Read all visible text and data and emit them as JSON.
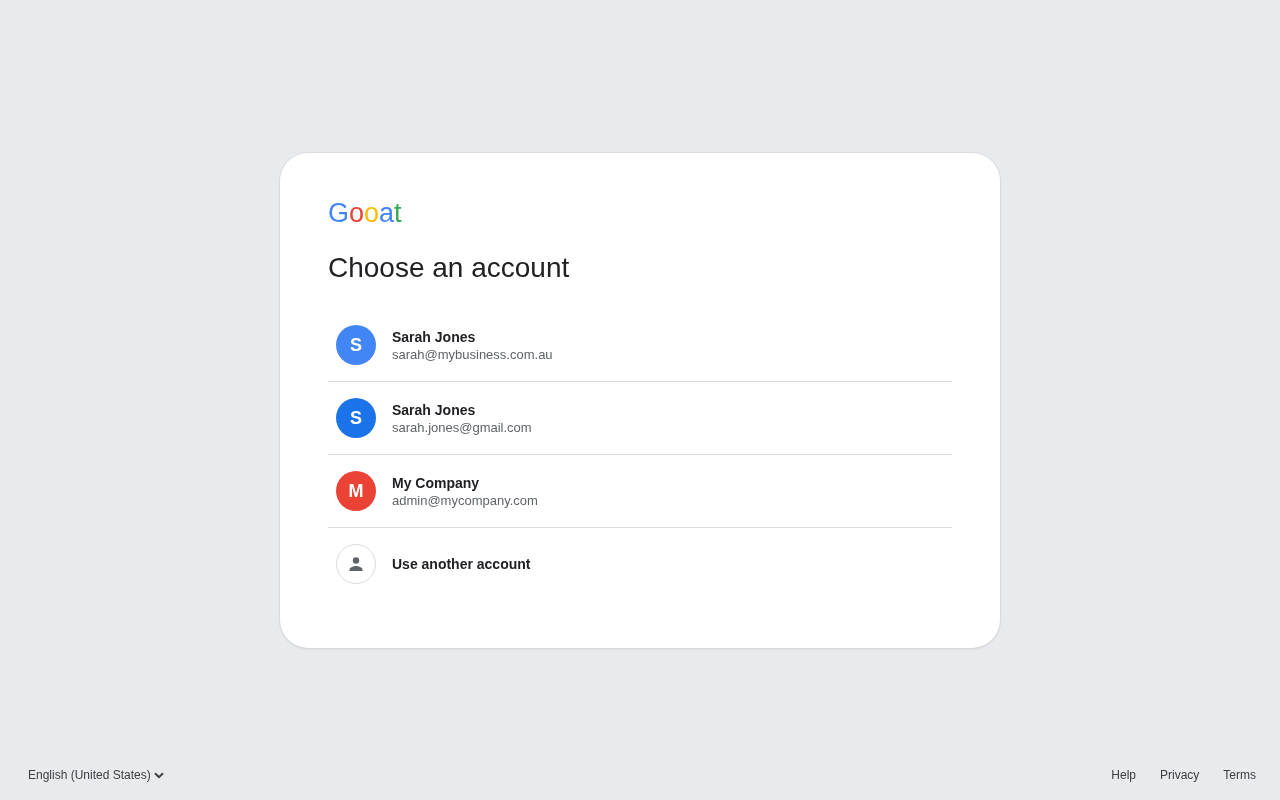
{
  "logo": {
    "text": "Gooat"
  },
  "title": "Choose an account",
  "accounts": [
    {
      "kind": "account",
      "initial": "S",
      "name": "Sarah Jones",
      "email": "sarah@mybusiness.com.au",
      "color": "#4285f4"
    },
    {
      "kind": "account",
      "initial": "S",
      "name": "Sarah Jones",
      "email": "sarah.jones@gmail.com",
      "color": "#1a73e8"
    },
    {
      "kind": "account",
      "initial": "M",
      "name": "My Company",
      "email": "admin@mycompany.com",
      "color": "#ea4335"
    },
    {
      "kind": "other",
      "label": "Use another account"
    }
  ],
  "footer": {
    "language": "English (United States)",
    "links": [
      "Help",
      "Privacy",
      "Terms"
    ]
  }
}
